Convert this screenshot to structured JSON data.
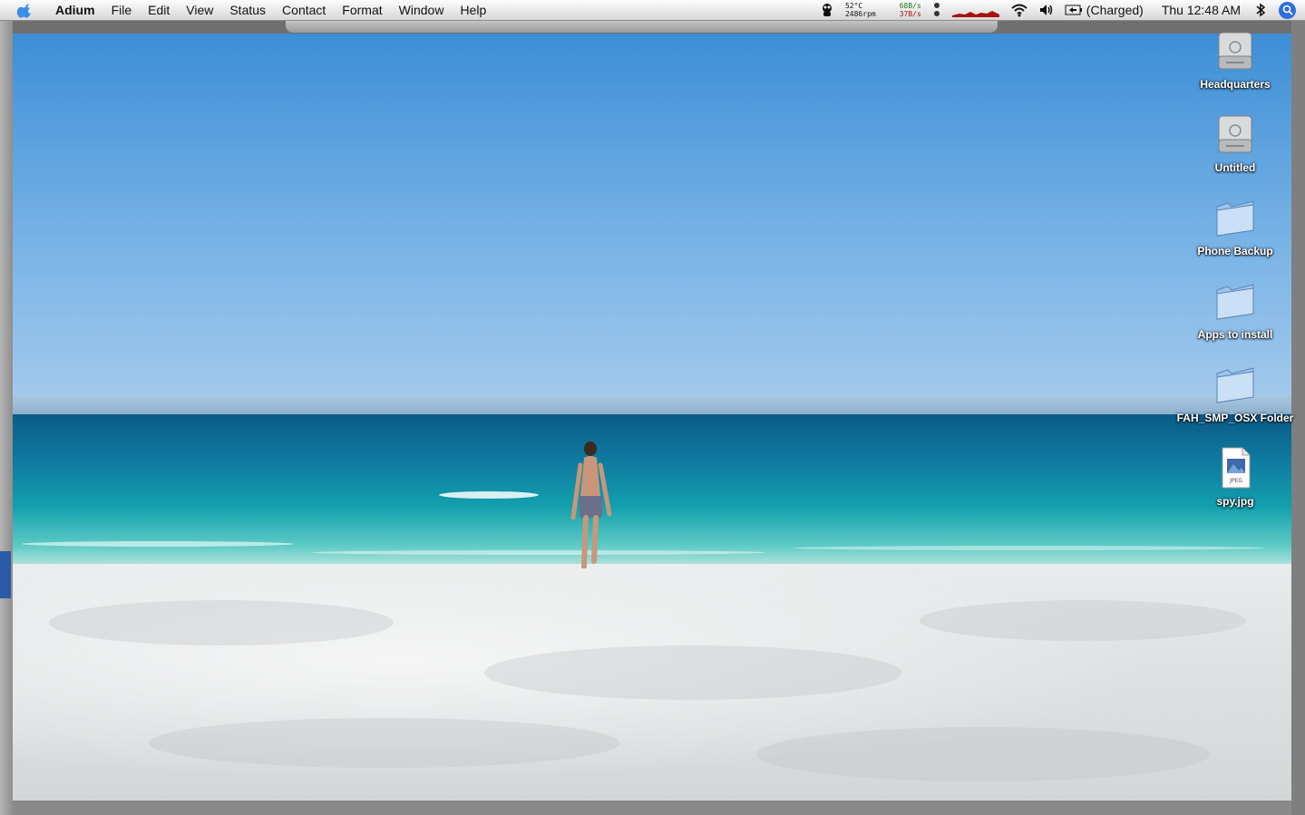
{
  "menubar": {
    "apple_icon": "apple-logo-icon",
    "app_name": "Adium",
    "menus": [
      "File",
      "Edit",
      "View",
      "Status",
      "Contact",
      "Format",
      "Window",
      "Help"
    ],
    "status": {
      "temperature": "52°C",
      "fan_speed": "2486rpm",
      "net_up": "68B/s",
      "net_down": "37B/s",
      "battery": "(Charged)",
      "clock": "Thu 12:48 AM"
    }
  },
  "desktop": {
    "icons": [
      {
        "label": "Headquarters",
        "type": "hard-drive-icon"
      },
      {
        "label": "Untitled",
        "type": "hard-drive-icon"
      },
      {
        "label": "Phone Backup",
        "type": "folder-icon"
      },
      {
        "label": "Apps to install",
        "type": "folder-icon"
      },
      {
        "label": "FAH_SMP_OSX Folder",
        "type": "folder-icon"
      },
      {
        "label": "spy.jpg",
        "type": "jpeg-file-icon",
        "badge": "JPEG"
      }
    ]
  },
  "colors": {
    "accent": "#2f6fe0",
    "sky": "#5aa2de",
    "sea": "#13a0ae",
    "sand": "#e4e7e8"
  }
}
